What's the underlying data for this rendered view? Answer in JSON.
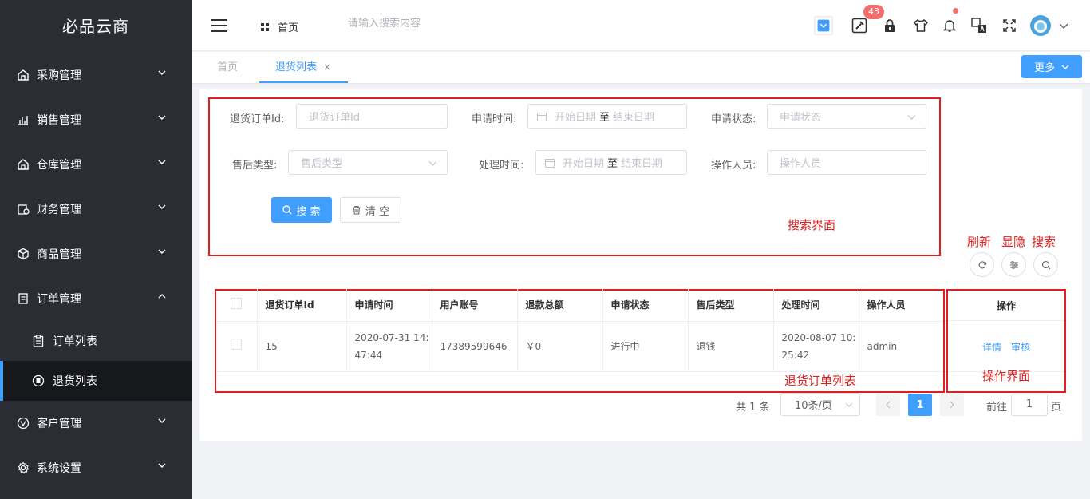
{
  "app": {
    "title": "必品云商"
  },
  "sidebar": {
    "items": [
      {
        "label": "采购管理",
        "icon": "purchase-icon"
      },
      {
        "label": "销售管理",
        "icon": "sales-chart-icon"
      },
      {
        "label": "仓库管理",
        "icon": "warehouse-icon"
      },
      {
        "label": "财务管理",
        "icon": "finance-icon"
      },
      {
        "label": "商品管理",
        "icon": "box-icon"
      },
      {
        "label": "订单管理",
        "icon": "order-doc-icon",
        "expanded": true
      },
      {
        "label": "客户管理",
        "icon": "customer-icon"
      },
      {
        "label": "系统设置",
        "icon": "gear-icon"
      }
    ],
    "sub_items": [
      {
        "label": "订单列表",
        "icon": "clipboard-icon"
      },
      {
        "label": "退货列表",
        "icon": "return-icon",
        "active": true
      }
    ]
  },
  "header": {
    "home_label": "首页",
    "search_placeholder": "请输入搜索内容",
    "badge_count": "43"
  },
  "tabs": {
    "home": "首页",
    "active": "退货列表",
    "close": "×",
    "more": "更多"
  },
  "search_form": {
    "order_id_label": "退货订单Id:",
    "order_id_placeholder": "退货订单Id",
    "apply_time_label": "申请时间:",
    "start_date": "开始日期",
    "to": "至",
    "end_date": "结束日期",
    "apply_status_label": "申请状态:",
    "apply_status_placeholder": "申请状态",
    "after_sale_label": "售后类型:",
    "after_sale_placeholder": "售后类型",
    "process_time_label": "处理时间:",
    "operator_label": "操作人员:",
    "operator_placeholder": "操作人员",
    "search_btn": "搜 索",
    "clear_btn": "清 空"
  },
  "annotations": {
    "search_area": "搜索界面",
    "refresh": "刷新",
    "toggle": "显隐",
    "search": "搜索",
    "list_area": "退货订单列表",
    "ops_area": "操作界面"
  },
  "table": {
    "columns": [
      "退货订单Id",
      "申请时间",
      "用户账号",
      "退款总额",
      "申请状态",
      "售后类型",
      "处理时间",
      "操作人员"
    ],
    "ops_header": "操作",
    "rows": [
      {
        "id": "15",
        "apply_time_1": "2020-07-31 14:",
        "apply_time_2": "47:44",
        "account": "17389599646",
        "amount": "￥0",
        "status": "进行中",
        "type": "退钱",
        "process_time_1": "2020-08-07 10:",
        "process_time_2": "25:42",
        "operator": "admin",
        "detail": "详情",
        "review": "审核"
      }
    ]
  },
  "pagination": {
    "total": "共 1 条",
    "page_size": "10条/页",
    "current": "1",
    "goto_label": "前往",
    "goto_value": "1",
    "unit": "页"
  },
  "colors": {
    "primary": "#409eff",
    "sidebar_bg": "#2a2d33",
    "annotation": "#e02020",
    "badge": "#f56c6c"
  }
}
